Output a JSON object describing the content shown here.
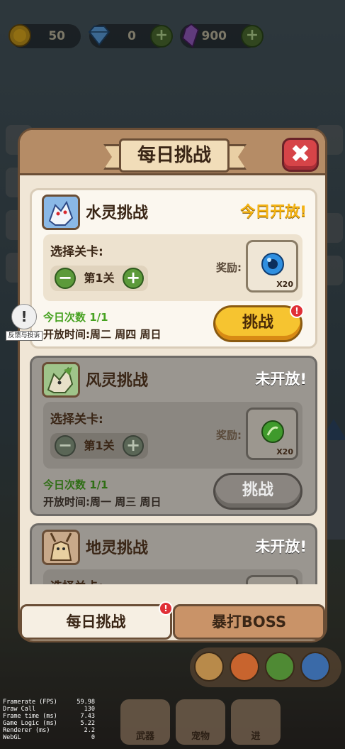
{
  "resources": [
    {
      "icon": "gold-coin-icon",
      "value": "50",
      "color": "#e8b21e"
    },
    {
      "icon": "diamond-icon",
      "value": "0",
      "color": "#5fa7e8"
    },
    {
      "icon": "purple-crystal-icon",
      "value": "900",
      "color": "#9b5fc8"
    }
  ],
  "panel": {
    "title": "每日挑战",
    "close_symbol": "✖"
  },
  "cards": [
    {
      "name": "水灵挑战",
      "status": "今日开放!",
      "open": true,
      "select_label": "选择关卡:",
      "stage": "第1关",
      "reward_label": "奖励:",
      "reward_count": "X20",
      "reward_color": "#2f8fe0",
      "count": "今日次数 1/1",
      "time": "开放时间:周二 周四 周日",
      "button": "挑战",
      "badge": "!"
    },
    {
      "name": "风灵挑战",
      "status": "未开放!",
      "open": false,
      "select_label": "选择关卡:",
      "stage": "第1关",
      "reward_label": "奖励:",
      "reward_count": "X20",
      "reward_color": "#3f9a2c",
      "count": "今日次数 1/1",
      "time": "开放时间:周一 周三 周日",
      "button": "挑战"
    },
    {
      "name": "地灵挑战",
      "status": "未开放!",
      "open": false,
      "select_label": "选择关卡:"
    }
  ],
  "tabs": {
    "daily": "每日挑战",
    "boss": "暴打BOSS",
    "badge": "!"
  },
  "feedback": {
    "icon": "!",
    "label": "反馈与投诉"
  },
  "bottom_nav": {
    "weapon": "武器",
    "pet": "宠物",
    "advance": "进"
  },
  "stats": [
    {
      "k": "Framerate (FPS)",
      "v": "59.98"
    },
    {
      "k": "Draw Call",
      "v": "130"
    },
    {
      "k": "Frame time (ms)",
      "v": "7.43"
    },
    {
      "k": "Game Logic (ms)",
      "v": "5.22"
    },
    {
      "k": "Renderer (ms)",
      "v": "2.2"
    },
    {
      "k": "WebGL",
      "v": "0"
    }
  ]
}
